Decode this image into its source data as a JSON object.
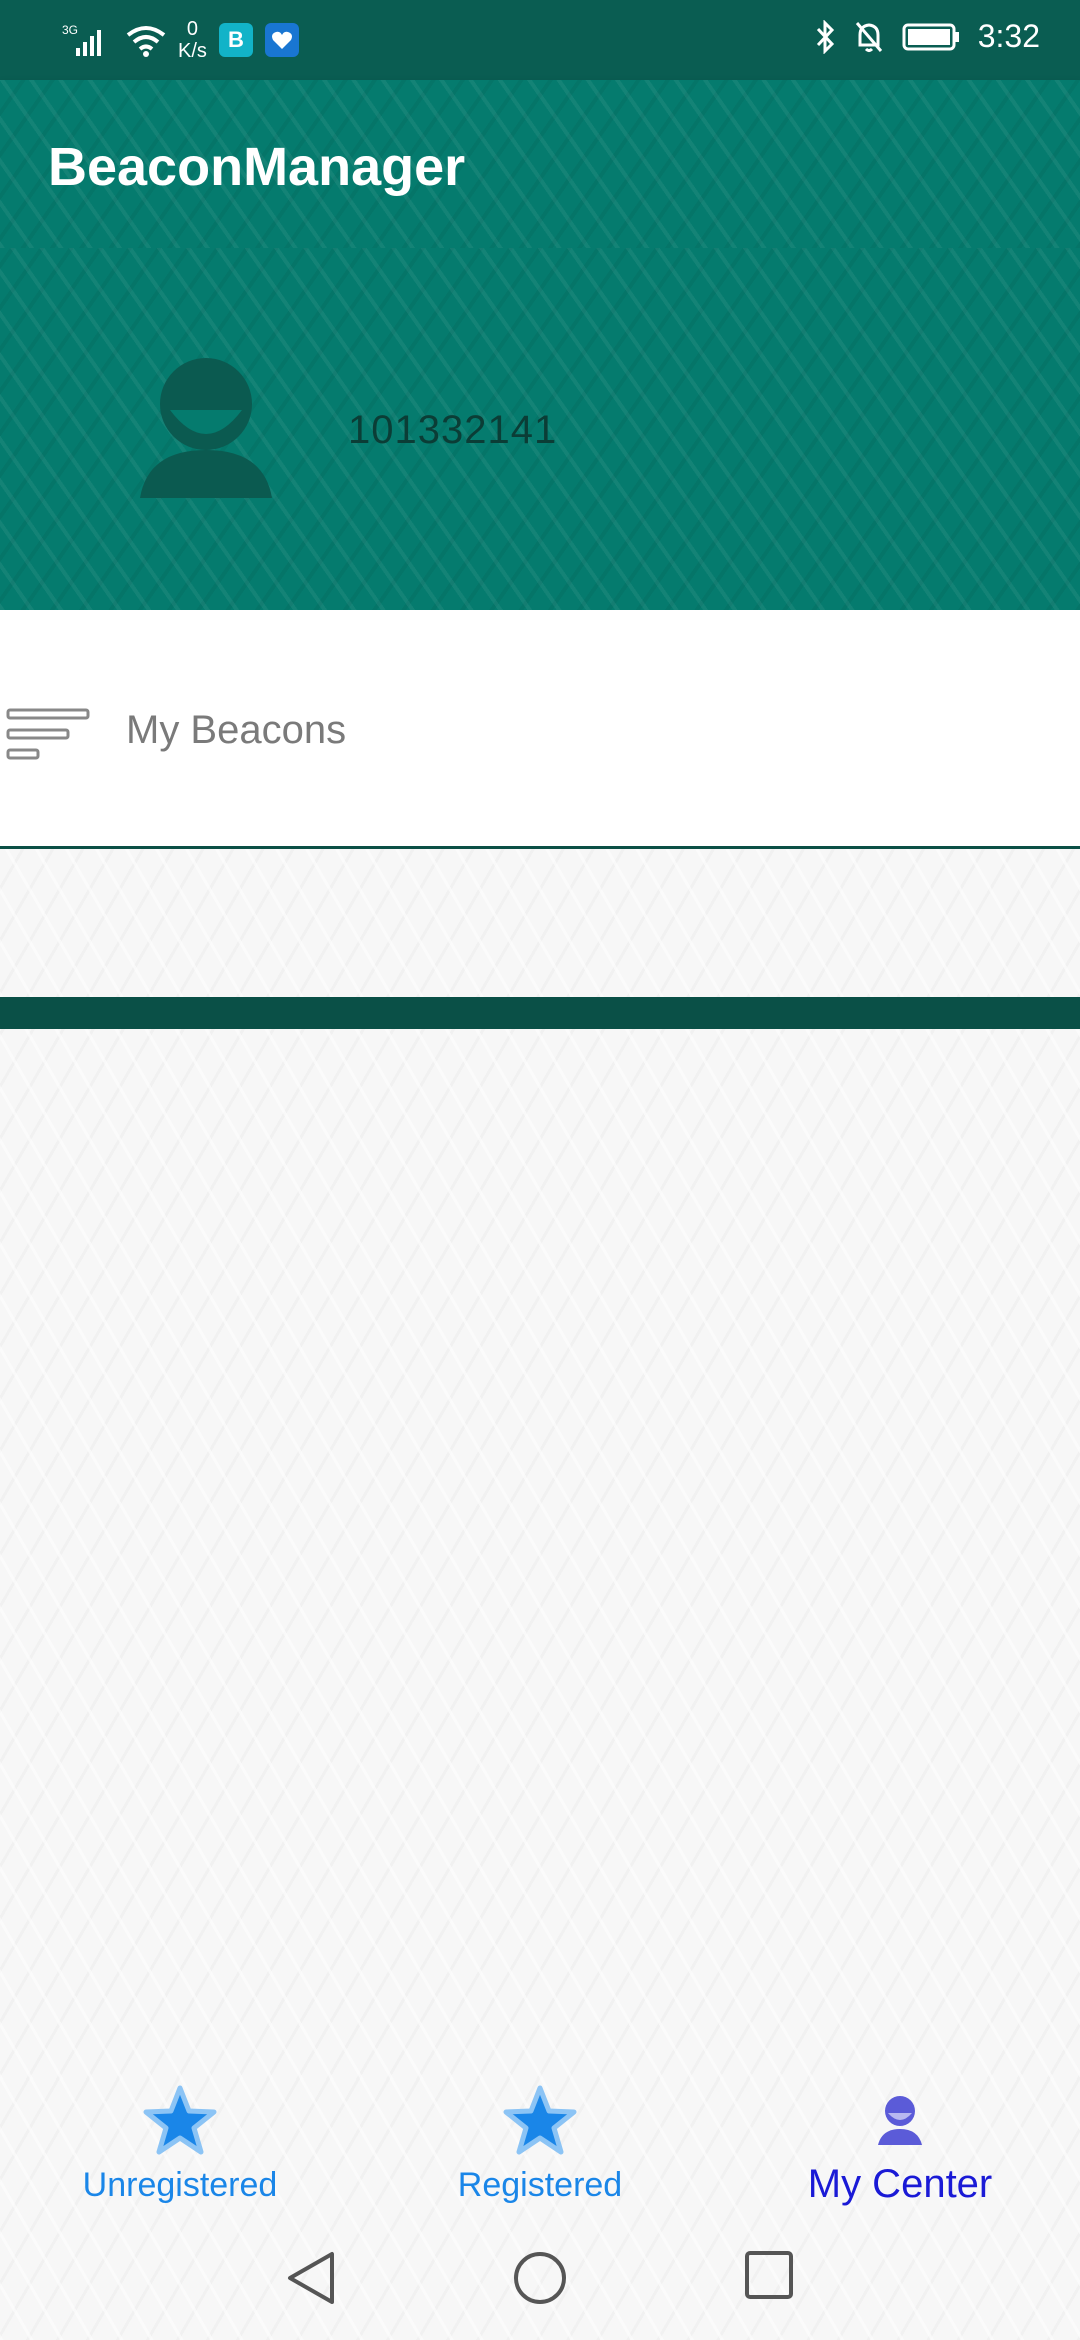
{
  "status_bar": {
    "network": "3G",
    "speed_value": "0",
    "speed_unit": "K/s",
    "time": "3:32",
    "app_icon_1": "B",
    "colors": {
      "background": "#0a5d52"
    }
  },
  "app_bar": {
    "title": "BeaconManager"
  },
  "profile": {
    "user_id": "101332141"
  },
  "menu": {
    "items": [
      {
        "label": "My Beacons",
        "icon": "list-lines-icon"
      }
    ]
  },
  "bottom_nav": {
    "items": [
      {
        "label": "Unregistered",
        "icon": "star-icon",
        "active": false
      },
      {
        "label": "Registered",
        "icon": "star-icon",
        "active": false
      },
      {
        "label": "My Center",
        "icon": "person-icon",
        "active": true
      }
    ]
  },
  "colors": {
    "primary": "#057b6e",
    "primary_dark": "#0a5047",
    "nav_inactive": "#1a86e8",
    "nav_active": "#1a1ad6"
  }
}
